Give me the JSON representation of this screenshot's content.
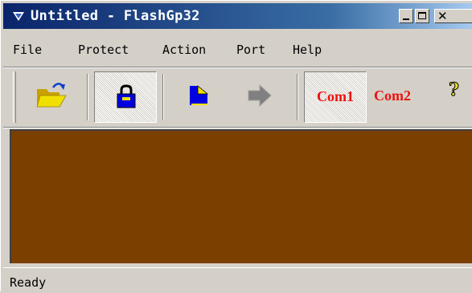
{
  "window": {
    "title": "Untitled - FlashGp32",
    "titlebar_gradient": [
      "#0a246a",
      "#a6caf0"
    ]
  },
  "menu": {
    "items": [
      "File",
      "Protect",
      "Action",
      "Port",
      "Help"
    ]
  },
  "toolbar": {
    "buttons": [
      {
        "name": "open",
        "icon": "open-folder-icon"
      },
      {
        "name": "protect",
        "icon": "lock-icon",
        "pressed": true
      },
      {
        "name": "read",
        "icon": "document-icon"
      },
      {
        "name": "action",
        "icon": "arrow-right-icon",
        "disabled": true
      },
      {
        "name": "com1",
        "label": "Com1",
        "pressed": true
      },
      {
        "name": "com2",
        "label": "Com2"
      },
      {
        "name": "help",
        "icon": "help-icon"
      }
    ],
    "com_color": "#ee1111"
  },
  "client": {
    "background": "#7b3f00"
  },
  "status": {
    "text": "Ready"
  }
}
